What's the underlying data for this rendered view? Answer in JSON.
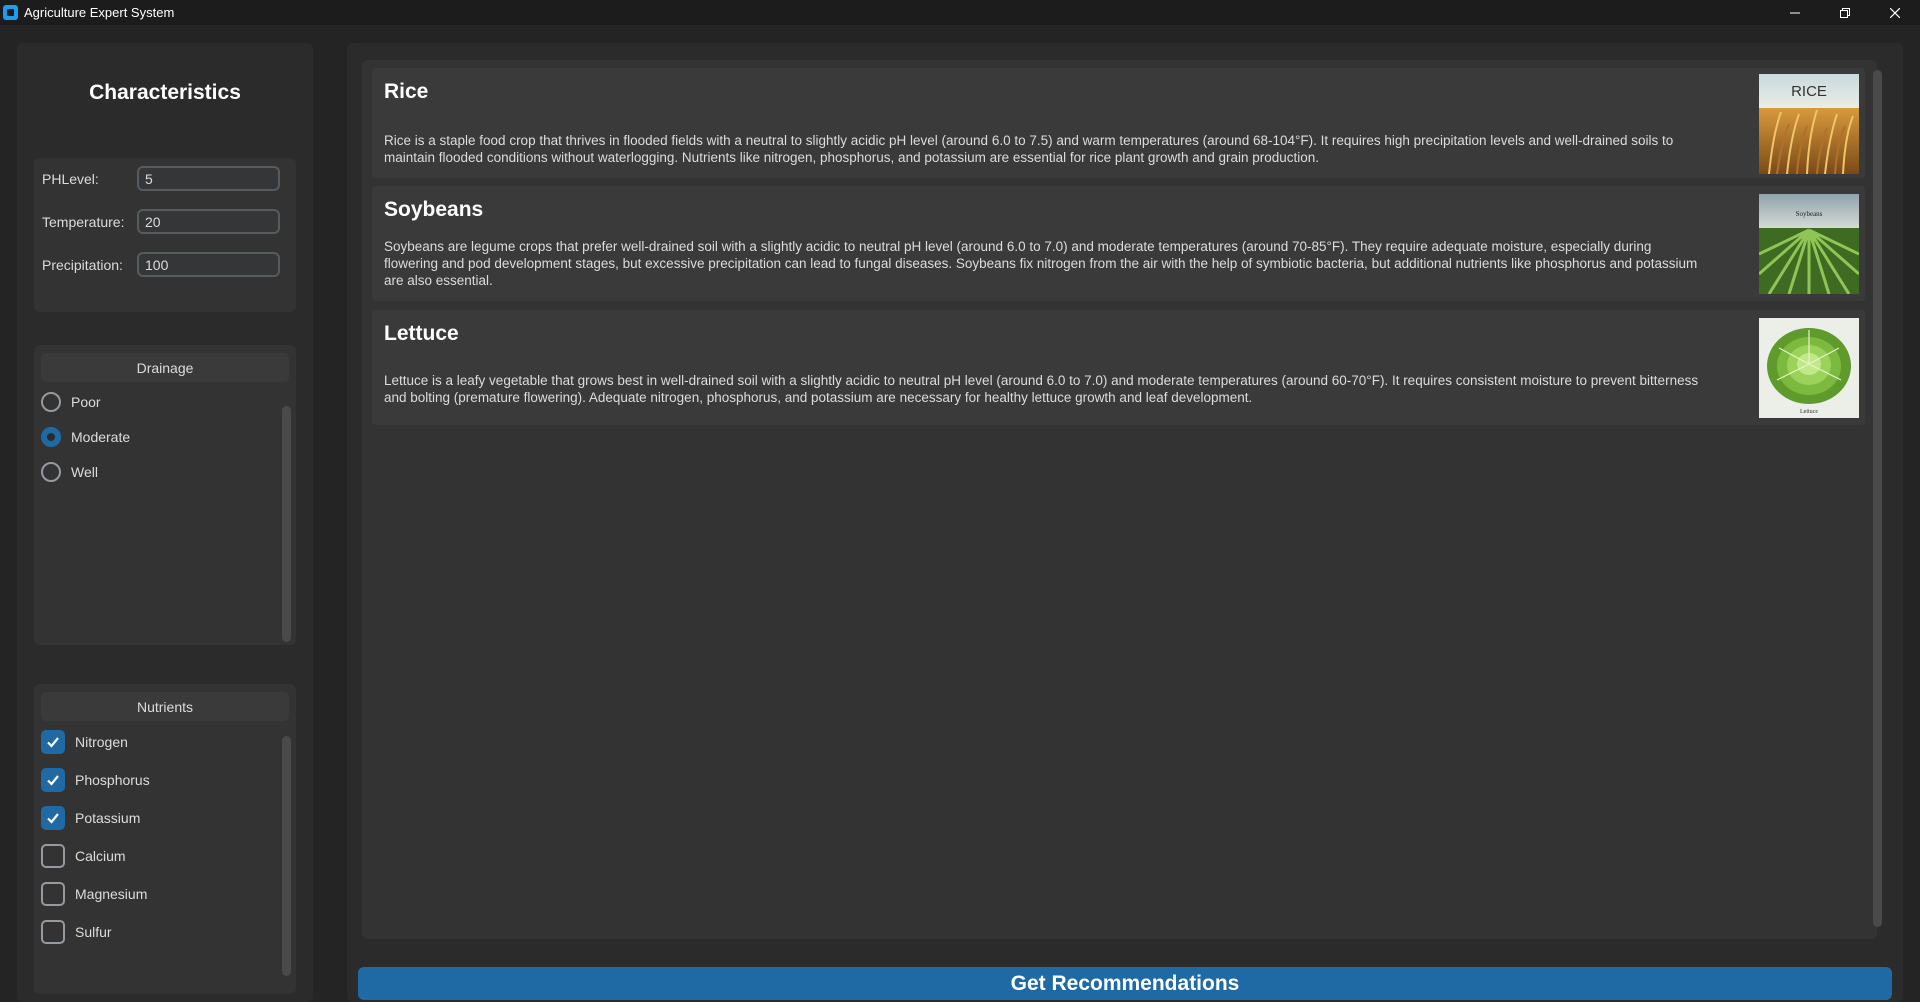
{
  "window": {
    "title": "Agriculture Expert System"
  },
  "sidebar": {
    "title": "Characteristics",
    "fields": [
      {
        "label": "PHLevel:",
        "value": "5"
      },
      {
        "label": "Temperature:",
        "value": "20"
      },
      {
        "label": "Precipitation:",
        "value": "100"
      }
    ],
    "drainage": {
      "header": "Drainage",
      "options": [
        {
          "label": "Poor",
          "checked": false
        },
        {
          "label": "Moderate",
          "checked": true
        },
        {
          "label": "Well",
          "checked": false
        }
      ]
    },
    "nutrients": {
      "header": "Nutrients",
      "options": [
        {
          "label": "Nitrogen",
          "checked": true
        },
        {
          "label": "Phosphorus",
          "checked": true
        },
        {
          "label": "Potassium",
          "checked": true
        },
        {
          "label": "Calcium",
          "checked": false
        },
        {
          "label": "Magnesium",
          "checked": false
        },
        {
          "label": "Sulfur",
          "checked": false
        }
      ]
    }
  },
  "results": [
    {
      "name": "Rice",
      "description": "Rice is a staple food crop that thrives in flooded fields with a neutral to slightly acidic pH level (around 6.0 to 7.5) and warm temperatures (around 68-104°F). It requires high precipitation levels and well-drained soils to maintain flooded conditions without waterlogging. Nutrients like nitrogen, phosphorus, and potassium are essential for rice plant growth and grain production.",
      "image_label": "RICE"
    },
    {
      "name": "Soybeans",
      "description": "Soybeans are legume crops that prefer well-drained soil with a slightly acidic to neutral pH level (around 6.0 to 7.0) and moderate temperatures (around 70-85°F). They require adequate moisture, especially during flowering and pod development stages, but excessive precipitation can lead to fungal diseases. Soybeans fix nitrogen from the air with the help of symbiotic bacteria, but additional nutrients like phosphorus and potassium are also essential.",
      "image_label": "Soybeans"
    },
    {
      "name": "Lettuce",
      "description": "Lettuce is a leafy vegetable that grows best in well-drained soil with a slightly acidic to neutral pH level (around 6.0 to 7.0) and moderate temperatures (around 60-70°F). It requires consistent moisture to prevent bitterness and bolting (premature flowering). Adequate nitrogen, phosphorus, and potassium are necessary for healthy lettuce growth and leaf development.",
      "image_label": "Lettuce"
    }
  ],
  "action": {
    "label": "Get Recommendations"
  },
  "colors": {
    "accent": "#1f6aa5",
    "background": "#242424",
    "panel": "#2b2b2b"
  }
}
